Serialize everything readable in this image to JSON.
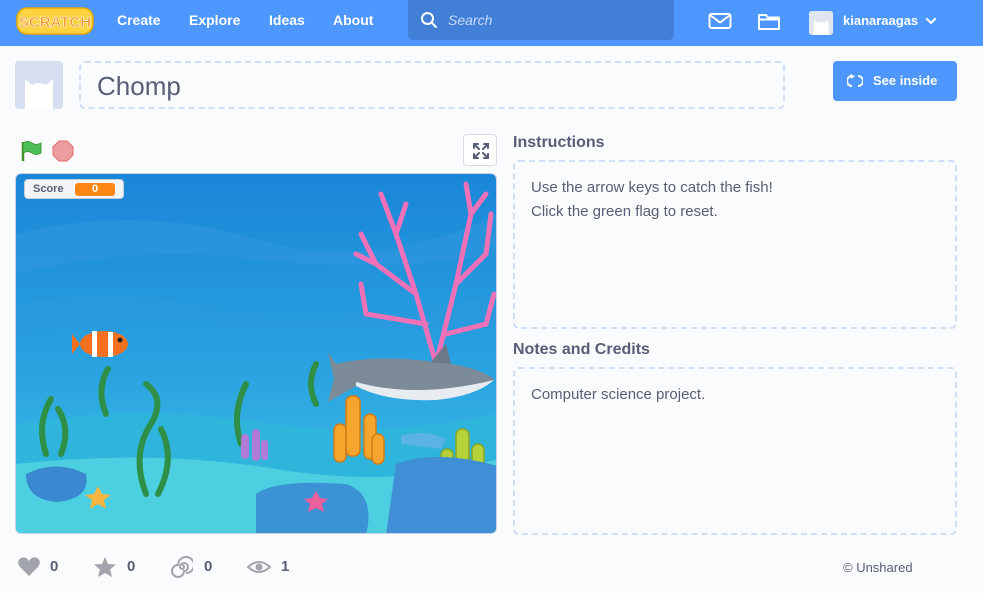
{
  "nav": {
    "logo_text": "SCRATCH",
    "links": [
      "Create",
      "Explore",
      "Ideas",
      "About"
    ],
    "search_placeholder": "Search",
    "username": "kianaraagas"
  },
  "project": {
    "title": "Chomp",
    "see_inside_label": "See inside"
  },
  "stage": {
    "score_label": "Score",
    "score_value": "0"
  },
  "instructions": {
    "heading": "Instructions",
    "lines": [
      "Use the arrow keys to catch the fish!",
      "Click the green flag to reset."
    ]
  },
  "notes": {
    "heading": "Notes and Credits",
    "text": "Computer science project."
  },
  "stats": {
    "loves": "0",
    "favorites": "0",
    "remixes": "0",
    "views": "1"
  },
  "share_status": "© Unshared",
  "colors": {
    "brand_blue": "#4d97ff",
    "search_blue": "#4280d7",
    "score_orange": "#fe8613"
  }
}
